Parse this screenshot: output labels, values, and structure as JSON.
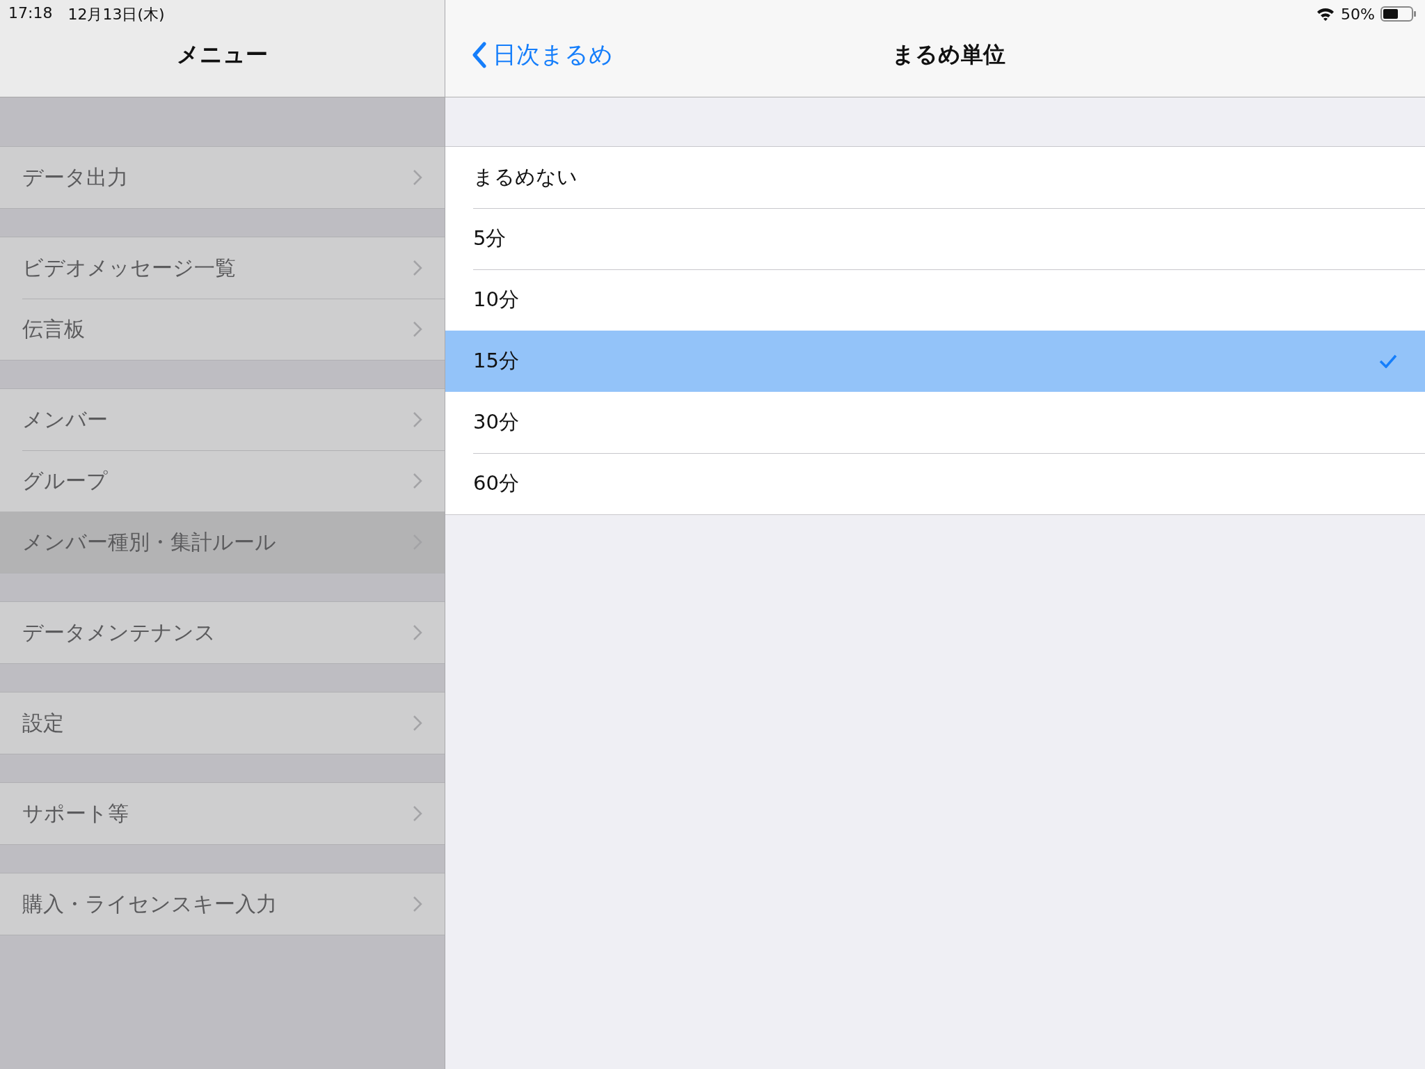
{
  "status_bar": {
    "time": "17:18",
    "date": "12月13日(木)",
    "battery": "50%"
  },
  "sidebar": {
    "title": "メニュー",
    "sections": [
      {
        "items": [
          {
            "label": "データ出力",
            "selected": false
          }
        ]
      },
      {
        "items": [
          {
            "label": "ビデオメッセージ一覧",
            "selected": false
          },
          {
            "label": "伝言板",
            "selected": false
          }
        ]
      },
      {
        "items": [
          {
            "label": "メンバー",
            "selected": false
          },
          {
            "label": "グループ",
            "selected": false
          },
          {
            "label": "メンバー種別・集計ルール",
            "selected": true
          }
        ]
      },
      {
        "items": [
          {
            "label": "データメンテナンス",
            "selected": false
          }
        ]
      },
      {
        "items": [
          {
            "label": "設定",
            "selected": false
          }
        ]
      },
      {
        "items": [
          {
            "label": "サポート等",
            "selected": false
          }
        ]
      },
      {
        "items": [
          {
            "label": "購入・ライセンスキー入力",
            "selected": false
          }
        ]
      }
    ]
  },
  "detail": {
    "back": "日次まるめ",
    "title": "まるめ単位",
    "options": [
      {
        "label": "まるめない",
        "selected": false
      },
      {
        "label": "5分",
        "selected": false
      },
      {
        "label": "10分",
        "selected": false
      },
      {
        "label": "15分",
        "selected": true
      },
      {
        "label": "30分",
        "selected": false
      },
      {
        "label": "60分",
        "selected": false
      }
    ]
  }
}
